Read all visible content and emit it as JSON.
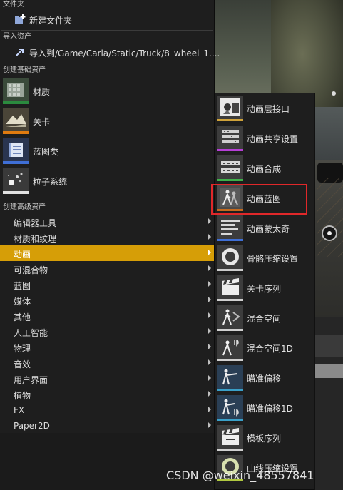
{
  "sections": {
    "folder": "文件夹",
    "import": "导入资产",
    "basic": "创建基础资产",
    "advanced": "创建高级资产"
  },
  "folder_item": {
    "label": "新建文件夹",
    "icon": "new-folder-icon"
  },
  "import_item": {
    "label": "导入到/Game/Carla/Static/Truck/8_wheel_1....",
    "icon": "import-icon"
  },
  "basic_assets": [
    {
      "label": "材质",
      "icon": "material-icon",
      "bar_color": "#2b8a3e"
    },
    {
      "label": "关卡",
      "icon": "level-icon",
      "bar_color": "#e07b10"
    },
    {
      "label": "蓝图类",
      "icon": "blueprint-class-icon",
      "bar_color": "#3f6fd6"
    },
    {
      "label": "粒子系统",
      "icon": "particle-system-icon",
      "bar_color": "#e0e0e0"
    }
  ],
  "advanced_assets": [
    {
      "label": "编辑器工具"
    },
    {
      "label": "材质和纹理"
    },
    {
      "label": "动画",
      "selected": true
    },
    {
      "label": "可混合物"
    },
    {
      "label": "蓝图"
    },
    {
      "label": "媒体"
    },
    {
      "label": "其他"
    },
    {
      "label": "人工智能"
    },
    {
      "label": "物理"
    },
    {
      "label": "音效"
    },
    {
      "label": "用户界面"
    },
    {
      "label": "植物"
    },
    {
      "label": "FX"
    },
    {
      "label": "Paper2D"
    }
  ],
  "animation_submenu": [
    {
      "label": "动画层接口",
      "icon": "anim-layer-interface-icon",
      "bar_color": "#cfa23a"
    },
    {
      "label": "动画共享设置",
      "icon": "anim-sharing-setup-icon",
      "bar_color": "#b63fd6"
    },
    {
      "label": "动画合成",
      "icon": "anim-composite-icon",
      "bar_color": "#3fb04a"
    },
    {
      "label": "动画蓝图",
      "icon": "anim-blueprint-icon",
      "bar_color": "#c46a1e",
      "highlighted": true
    },
    {
      "label": "动画蒙太奇",
      "icon": "anim-montage-icon",
      "bar_color": "#3f6fd6"
    },
    {
      "label": "骨骼压缩设置",
      "icon": "bone-compression-icon",
      "bar_color": "#cccccc"
    },
    {
      "label": "关卡序列",
      "icon": "level-sequence-icon",
      "bar_color": "#d0d0d0"
    },
    {
      "label": "混合空间",
      "icon": "blend-space-icon",
      "bar_color": "#d0d0d0"
    },
    {
      "label": "混合空间1D",
      "icon": "blend-space-1d-icon",
      "bar_color": "#d0d0d0"
    },
    {
      "label": "瞄准偏移",
      "icon": "aim-offset-icon",
      "bar_color": "#3aa0c8"
    },
    {
      "label": "瞄准偏移1D",
      "icon": "aim-offset-1d-icon",
      "bar_color": "#3aa0c8"
    },
    {
      "label": "模板序列",
      "icon": "template-sequence-icon",
      "bar_color": "#d0d0d0"
    },
    {
      "label": "曲线压缩设置",
      "icon": "curve-compression-icon",
      "bar_color": "#b0c840"
    }
  ],
  "watermark": "CSDN @weixin_48557841",
  "colors": {
    "selected_row": "#d69e07",
    "highlight_box": "#e0282a"
  }
}
